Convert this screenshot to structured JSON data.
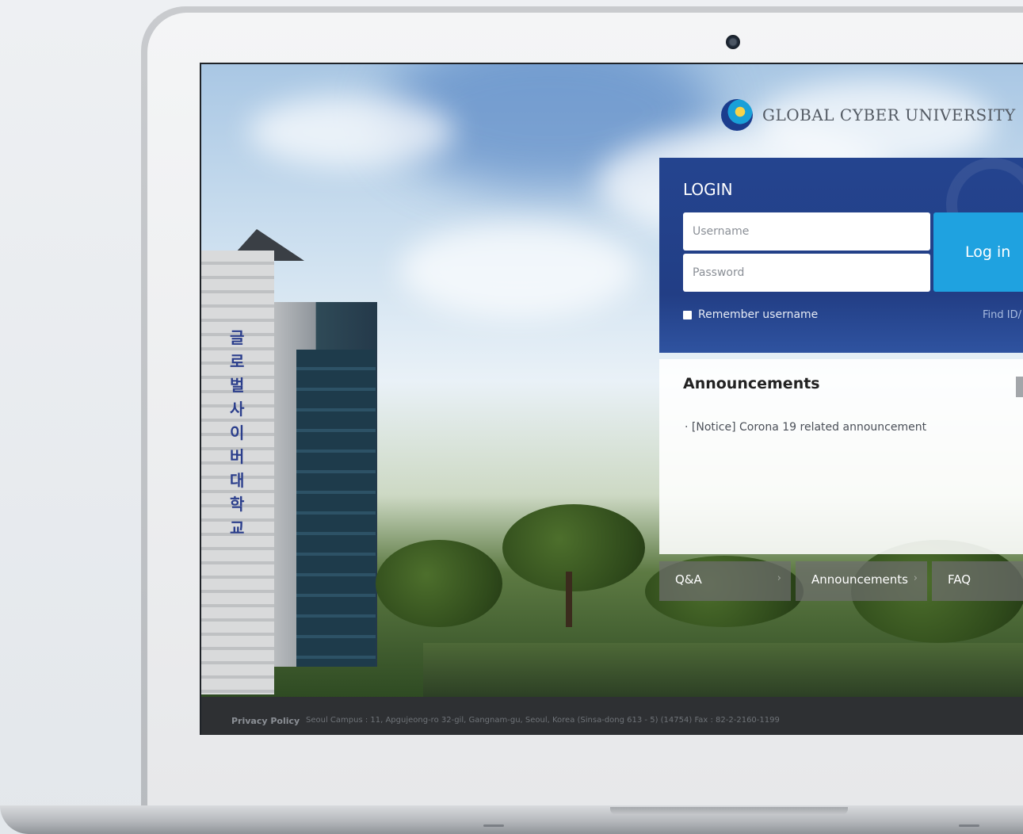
{
  "brand": {
    "name": "GLOBAL CYBER UNIVERSITY"
  },
  "login": {
    "title": "LOGIN",
    "username_placeholder": "Username",
    "password_placeholder": "Password",
    "button_label": "Log in",
    "remember_label": "Remember username",
    "find_label": "Find ID/"
  },
  "announcements": {
    "title": "Announcements",
    "items": [
      "· [Notice] Corona 19 related announcement"
    ]
  },
  "quick_links": [
    {
      "label": "Q&A"
    },
    {
      "label": "Announcements"
    },
    {
      "label": "FAQ"
    }
  ],
  "footer": {
    "privacy_label": "Privacy Policy",
    "address": "Seoul Campus : 11, Apgujeong-ro 32-gil, Gangnam-gu, Seoul, Korea (Sinsa-dong 613 - 5) (14754)   Fax : 82-2-2160-1199"
  },
  "colors": {
    "login_panel": "#24448f",
    "login_button": "#1fa2e0",
    "footer": "#2e3033"
  }
}
